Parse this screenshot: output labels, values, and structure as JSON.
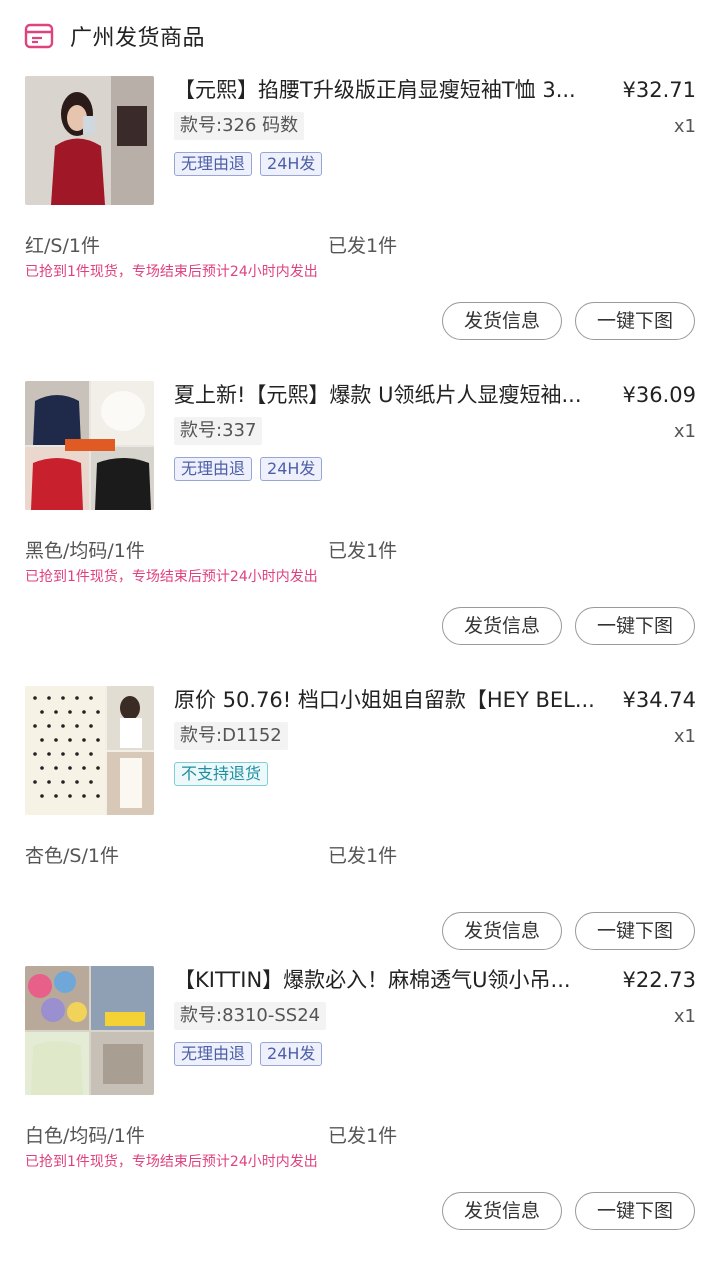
{
  "header": {
    "title": "广州发货商品",
    "icon": "box-icon"
  },
  "colors": {
    "accent": "#e0417f",
    "tag_blue": "#4d5fa8",
    "tag_teal": "#1f8fa0"
  },
  "products": [
    {
      "title": "【元熙】掐腰T升级版正肩显瘦短袖T恤  3...",
      "price": "¥32.71",
      "sku": "款号:326 码数",
      "qty": "x1",
      "tags": [
        "无理由退",
        "24H发"
      ],
      "spec": "红/S/1件",
      "shipped": "已发1件",
      "note": "已抢到1件现货，专场结束后预计24小时内发出",
      "btn_info": "发货信息",
      "btn_download": "一键下图"
    },
    {
      "title": "夏上新!【元熙】爆款 U领纸片人显瘦短袖...",
      "price": "¥36.09",
      "sku": "款号:337",
      "qty": "x1",
      "tags": [
        "无理由退",
        "24H发"
      ],
      "spec": "黑色/均码/1件",
      "shipped": "已发1件",
      "note": "已抢到1件现货，专场结束后预计24小时内发出",
      "btn_info": "发货信息",
      "btn_download": "一键下图"
    },
    {
      "title": "原价 50.76! 档口小姐姐自留款【HEY BEL...",
      "price": "¥34.74",
      "sku": "款号:D1152",
      "qty": "x1",
      "tags": [
        "不支持退货"
      ],
      "spec": "杏色/S/1件",
      "shipped": "已发1件",
      "note": "",
      "btn_info": "发货信息",
      "btn_download": "一键下图"
    },
    {
      "title": "【KITTIN】爆款必入！麻棉透气U领小吊...",
      "price": "¥22.73",
      "sku": "款号:8310-SS24",
      "qty": "x1",
      "tags": [
        "无理由退",
        "24H发"
      ],
      "spec": "白色/均码/1件",
      "shipped": "已发1件",
      "note": "已抢到1件现货，专场结束后预计24小时内发出",
      "btn_info": "发货信息",
      "btn_download": "一键下图"
    }
  ]
}
